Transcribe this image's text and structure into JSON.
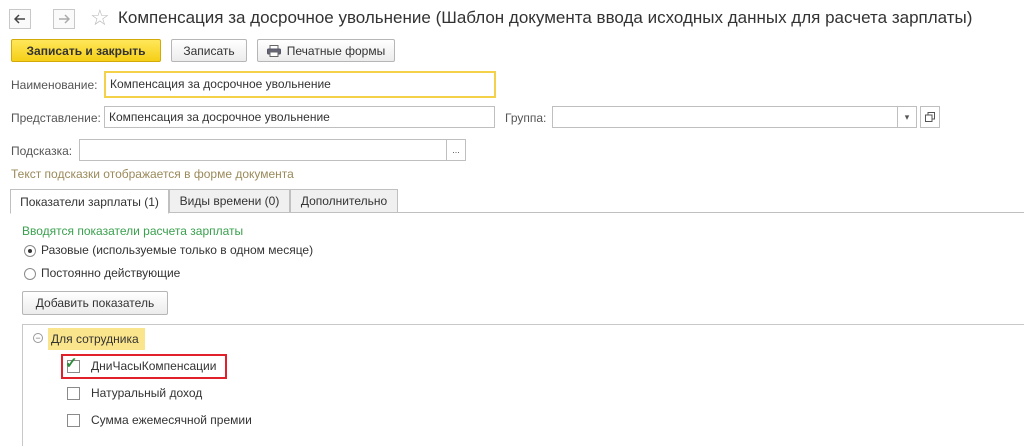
{
  "window": {
    "title": "Компенсация за досрочное увольнение (Шаблон документа ввода исходных данных для расчета зарплаты)",
    "back_icon": "arrow-left-icon",
    "forward_icon": "arrow-right-icon",
    "favorite_icon": "star-icon"
  },
  "toolbar": {
    "save_close_label": "Записать и закрыть",
    "save_label": "Записать",
    "print_label": "Печатные формы",
    "print_icon": "printer-icon"
  },
  "form": {
    "name_label": "Наименование:",
    "name_value": "Компенсация за досрочное увольнение",
    "presentation_label": "Представление:",
    "presentation_value": "Компенсация за досрочное увольнение",
    "group_label": "Группа:",
    "group_value": "",
    "hint_label": "Подсказка:",
    "hint_value": "",
    "hint_note": "Текст подсказки отображается в форме документа",
    "ellipsis": "..."
  },
  "tabs": [
    {
      "label": "Показатели зарплаты (1)",
      "active": true
    },
    {
      "label": "Виды времени (0)",
      "active": false
    },
    {
      "label": "Дополнительно",
      "active": false
    }
  ],
  "indicators": {
    "heading": "Вводятся показатели расчета зарплаты",
    "radio_options": [
      {
        "label": "Разовые (используемые только в одном месяце)",
        "selected": true
      },
      {
        "label": "Постоянно действующие",
        "selected": false
      }
    ],
    "add_button_label": "Добавить показатель"
  },
  "tree": {
    "group_label": "Для сотрудника",
    "items": [
      {
        "label": "ДниЧасыКомпенсации",
        "checked": true
      },
      {
        "label": "Натуральный доход",
        "checked": false
      },
      {
        "label": "Сумма ежемесячной премии",
        "checked": false
      }
    ]
  },
  "colors": {
    "accent_yellow": "#f5cf17",
    "highlight_red": "#e0202a",
    "info_green": "#3aa04e"
  }
}
